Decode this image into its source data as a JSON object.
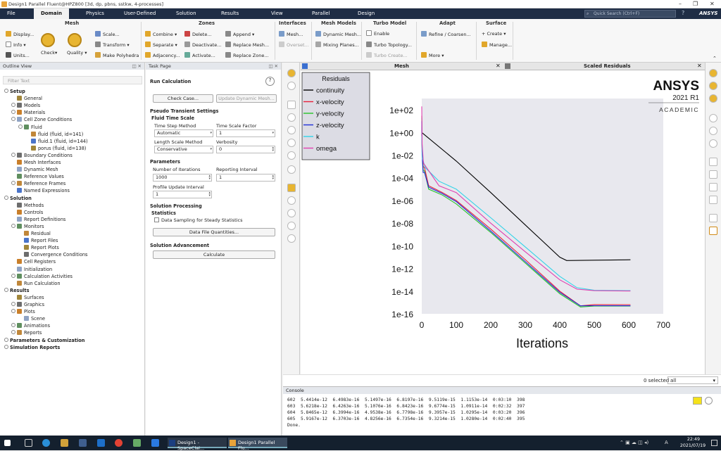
{
  "window": {
    "title": "Design1 Parallel Fluent@HPZ800  [3d, dp, pbns, sstkw, 4-processes]"
  },
  "menu": {
    "tabs": [
      "File",
      "Domain",
      "Physics",
      "User-Defined",
      "Solution",
      "Results",
      "View",
      "Parallel",
      "Design"
    ],
    "active": "Domain",
    "search_placeholder": "Quick Search (Ctrl+F)",
    "brand": "ANSYS"
  },
  "ribbon": {
    "mesh": {
      "title": "Mesh",
      "display": "Display...",
      "info": "Info",
      "units": "Units...",
      "check": "Check",
      "quality": "Quality",
      "scale": "Scale...",
      "transform": "Transform",
      "polyhedra": "Make Polyhedra"
    },
    "zones": {
      "title": "Zones",
      "combine": "Combine",
      "separate": "Separate",
      "adjacency": "Adjacency...",
      "delete": "Delete...",
      "deactivate": "Deactivate...",
      "activate": "Activate...",
      "append": "Append",
      "replace_mesh": "Replace Mesh...",
      "replace_zone": "Replace Zone..."
    },
    "interfaces": {
      "title": "Interfaces",
      "mesh": "Mesh...",
      "overset": "Overset..."
    },
    "mesh_models": {
      "title": "Mesh Models",
      "dynamic": "Dynamic Mesh...",
      "mixing": "Mixing Planes..."
    },
    "turbo": {
      "title": "Turbo Model",
      "enable": "Enable",
      "topology": "Turbo Topology...",
      "create": "Turbo Create..."
    },
    "adapt": {
      "title": "Adapt",
      "refine": "Refine / Coarsen...",
      "more": "More"
    },
    "surface": {
      "title": "Surface",
      "create": "+ Create",
      "manage": "Manage..."
    }
  },
  "outline": {
    "title": "Outline View",
    "filter_placeholder": "Filter Text",
    "items": [
      "Setup",
      "General",
      "Models",
      "Materials",
      "Cell Zone Conditions",
      "Fluid",
      "fluid (fluid, id=141)",
      "fluid.1 (fluid, id=144)",
      "porus (fluid, id=138)",
      "Boundary Conditions",
      "Mesh Interfaces",
      "Dynamic Mesh",
      "Reference Values",
      "Reference Frames",
      "Named Expressions",
      "Solution",
      "Methods",
      "Controls",
      "Report Definitions",
      "Monitors",
      "Residual",
      "Report Files",
      "Report Plots",
      "Convergence Conditions",
      "Cell Registers",
      "Initialization",
      "Calculation Activities",
      "Run Calculation",
      "Results",
      "Surfaces",
      "Graphics",
      "Plots",
      "Scene",
      "Animations",
      "Reports",
      "Parameters & Customization",
      "Simulation Reports"
    ]
  },
  "task": {
    "title": "Task Page",
    "heading": "Run Calculation",
    "check_case": "Check Case...",
    "update_mesh": "Update Dynamic Mesh...",
    "pseudo": "Pseudo Transient Settings",
    "fluid_time_scale": "Fluid Time Scale",
    "time_step_method_label": "Time Step Method",
    "time_step_method": "Automatic",
    "time_scale_factor_label": "Time Scale Factor",
    "time_scale_factor": "1",
    "length_scale_method_label": "Length Scale Method",
    "length_scale_method": "Conservative",
    "verbosity_label": "Verbosity",
    "verbosity": "0",
    "parameters": "Parameters",
    "iterations_label": "Number of Iterations",
    "iterations": "1000",
    "reporting_label": "Reporting Interval",
    "reporting": "1",
    "profile_label": "Profile Update Interval",
    "profile": "1",
    "processing": "Solution Processing",
    "statistics": "Statistics",
    "sampling": "Data Sampling for Steady Statistics",
    "data_file": "Data File Quantities...",
    "advancement": "Solution Advancement",
    "calculate": "Calculate"
  },
  "graphics": {
    "tabs": [
      "Mesh",
      "Scaled Residuals"
    ],
    "logo": {
      "brand": "ANSYS",
      "version": "2021 R1",
      "edition": "ACADEMIC"
    },
    "selected": "0 selected",
    "filter": "all"
  },
  "chart_data": {
    "type": "line",
    "title": "",
    "legend_title": "Residuals",
    "xlabel": "Iterations",
    "ylabel": "",
    "scale_y": "log",
    "xlim": [
      0,
      700
    ],
    "ylim": [
      1e-16,
      1000.0
    ],
    "x_ticks": [
      "0",
      "100",
      "200",
      "300",
      "400",
      "500",
      "600",
      "700"
    ],
    "y_ticks": [
      "1e+02",
      "1e+00",
      "1e-02",
      "1e-04",
      "1e-06",
      "1e-08",
      "1e-10",
      "1e-12",
      "1e-14",
      "1e-16"
    ],
    "legend_position": "top-left",
    "series": [
      {
        "name": "continuity",
        "color": "#000000",
        "x": [
          0,
          100,
          200,
          300,
          400,
          420,
          500,
          605
        ],
        "y": [
          1,
          0.003,
          5e-06,
          7e-09,
          1e-11,
          5e-12,
          5.4e-12,
          5.9e-12
        ]
      },
      {
        "name": "x-velocity",
        "color": "#e8203a",
        "x": [
          0,
          1,
          4,
          8,
          20,
          60,
          100,
          200,
          300,
          400,
          460,
          500,
          605
        ],
        "y": [
          30,
          0.05,
          0.001,
          0.0008,
          2e-05,
          5e-06,
          1e-06,
          3e-09,
          6e-12,
          1e-14,
          5e-16,
          6.5e-16,
          6.4e-16
        ]
      },
      {
        "name": "y-velocity",
        "color": "#27c427",
        "x": [
          0,
          1,
          4,
          8,
          20,
          60,
          100,
          200,
          300,
          400,
          460,
          500,
          605
        ],
        "y": [
          20,
          0.02,
          0.0005,
          0.0004,
          1e-05,
          3e-06,
          5e-07,
          1.5e-09,
          3e-12,
          6e-15,
          4e-16,
          4.8e-16,
          4.8e-16
        ]
      },
      {
        "name": "z-velocity",
        "color": "#1f2ed6",
        "x": [
          0,
          1,
          4,
          8,
          20,
          60,
          100,
          200,
          300,
          400,
          460,
          500,
          605
        ],
        "y": [
          10,
          0.01,
          0.0003,
          0.0003,
          1.5e-05,
          4e-06,
          8e-07,
          2e-09,
          4e-12,
          8e-15,
          5e-16,
          5.2e-16,
          5.1e-16
        ]
      },
      {
        "name": "k",
        "color": "#2fd3e8",
        "x": [
          0,
          2,
          10,
          50,
          100,
          200,
          300,
          400,
          450,
          500,
          605
        ],
        "y": [
          0.5,
          0.005,
          0.0008,
          5e-05,
          1e-05,
          3e-08,
          8e-11,
          2e-13,
          2e-14,
          1.2e-14,
          1.1e-14
        ]
      },
      {
        "name": "omega",
        "color": "#e040b0",
        "x": [
          0,
          1,
          5,
          50,
          100,
          200,
          300,
          400,
          450,
          500,
          605
        ],
        "y": [
          200,
          0.1,
          0.002,
          2e-05,
          5e-06,
          1e-08,
          3e-11,
          1e-13,
          1.5e-14,
          1.1e-14,
          1.03e-14
        ]
      }
    ]
  },
  "console": {
    "title": "Console",
    "lines": [
      "602  5.4414e-12  6.4983e-16  5.1497e-16  6.8197e-16  9.5119e-15  1.1153e-14  0:03:10  398",
      "603  5.6218e-12  6.4263e-16  5.1076e-16  6.8423e-16  9.6774e-15  1.0911e-14  0:02:32  397",
      "604  5.8465e-12  6.3994e-16  4.9538e-16  6.7798e-16  9.3957e-15  1.0295e-14  0:03:20  396",
      "605  5.9167e-12  6.3703e-16  4.8256e-16  6.7354e-16  9.3214e-15  1.0280e-14  0:02:40  395",
      "Done."
    ]
  },
  "taskbar": {
    "apps": [
      "Design1 - SpaceClai...",
      "Design1 Parallel Flu..."
    ],
    "time": "22:49",
    "date": "2021/07/19",
    "ime": "A"
  },
  "colors": {
    "menubar": "#1f2d45",
    "accent_gold": "#e8b531",
    "taskbar": "#14202e"
  }
}
